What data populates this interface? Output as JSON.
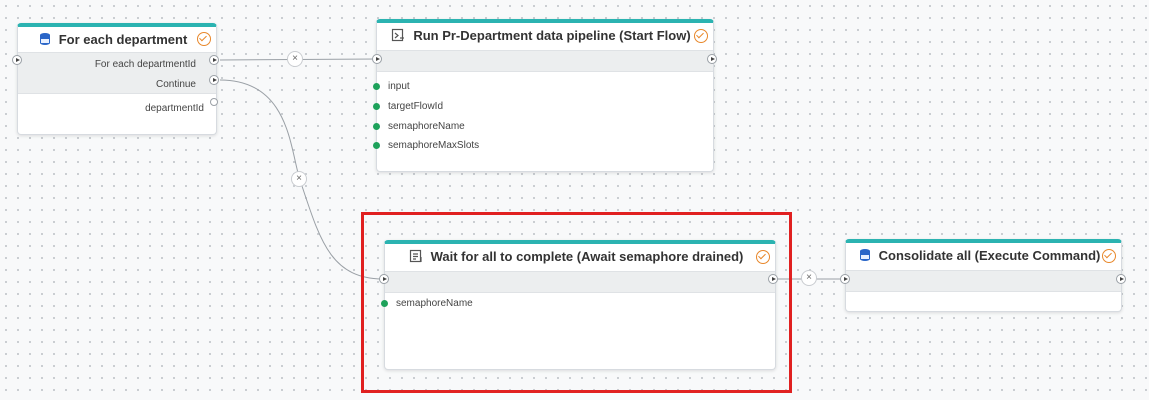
{
  "nodes": {
    "for_each": {
      "title": "For each department",
      "outputs": [
        "For each departmentId",
        "Continue"
      ],
      "variable": "departmentId",
      "icon": "database-icon"
    },
    "run_pipeline": {
      "title": "Run Pr-Department data pipeline (Start Flow)",
      "inputs": [
        "input",
        "targetFlowId",
        "semaphoreName",
        "semaphoreMaxSlots"
      ],
      "icon": "flow-icon"
    },
    "wait_all": {
      "title": "Wait for all to complete (Await semaphore drained)",
      "inputs": [
        "semaphoreName"
      ],
      "icon": "await-icon"
    },
    "consolidate": {
      "title": "Consolidate all (Execute Command)",
      "icon": "database-icon"
    }
  },
  "remove_link_symbol": "×",
  "colors": {
    "header_accent": "#2bb3b1",
    "status_check": "#e8872a",
    "input_dot": "#1ea25b",
    "highlight": "#e02020"
  }
}
